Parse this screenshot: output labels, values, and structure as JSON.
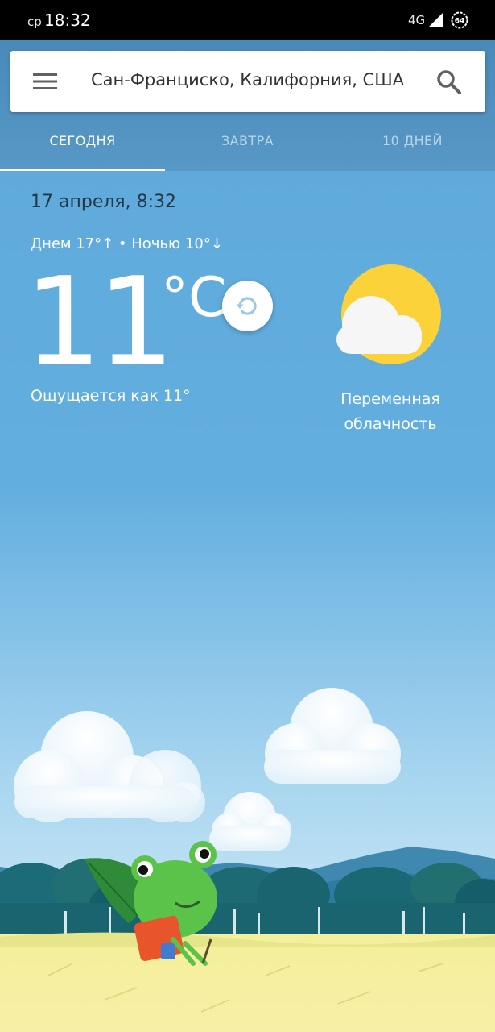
{
  "status_bar": {
    "day": "ср",
    "time": "18:32",
    "network": "4G",
    "battery": "64"
  },
  "search": {
    "location": "Сан-Франциско, Калифорния, США"
  },
  "tabs": [
    {
      "label": "СЕГОДНЯ",
      "active": true
    },
    {
      "label": "ЗАВТРА",
      "active": false
    },
    {
      "label": "10 ДНЕЙ",
      "active": false
    }
  ],
  "weather": {
    "date": "17 апреля, 8:32",
    "hilo": "Днем 17°↑ • Ночью 10°↓",
    "temperature": "11",
    "unit": "°C",
    "feels_like": "Ощущается как 11°",
    "condition": "Переменная облачность",
    "icon": "partly-cloudy-icon"
  },
  "colors": {
    "sky_top": "#5ba5d8",
    "sky_bottom": "#cfe9f7",
    "sun": "#fbd23a",
    "grass": "#f6ee9c",
    "frog": "#5bc24a",
    "backpack": "#e8552b"
  }
}
